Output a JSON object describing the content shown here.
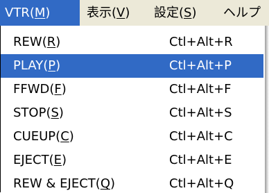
{
  "menubar": {
    "items": [
      {
        "text": "VTR",
        "mnemonic": "M",
        "active": true
      },
      {
        "text": "表示",
        "mnemonic": "V",
        "active": false
      },
      {
        "text": "設定",
        "mnemonic": "S",
        "active": false
      },
      {
        "text": "ヘルプ",
        "mnemonic": "",
        "active": false
      }
    ]
  },
  "vtr_menu": {
    "items": [
      {
        "text": "REW",
        "mnemonic": "R",
        "shortcut": "Ctl+Alt+R",
        "highlighted": false
      },
      {
        "text": "PLAY",
        "mnemonic": "P",
        "shortcut": "Ctl+Alt+P",
        "highlighted": true
      },
      {
        "text": "FFWD",
        "mnemonic": "F",
        "shortcut": "Ctl+Alt+F",
        "highlighted": false
      },
      {
        "text": "STOP",
        "mnemonic": "S",
        "shortcut": "Ctl+Alt+S",
        "highlighted": false
      },
      {
        "text": "CUEUP",
        "mnemonic": "C",
        "shortcut": "Ctl+Alt+C",
        "highlighted": false
      },
      {
        "text": "EJECT",
        "mnemonic": "E",
        "shortcut": "Ctl+Alt+E",
        "highlighted": false
      },
      {
        "text": "REW & EJECT",
        "mnemonic": "Q",
        "shortcut": "Ctl+Alt+Q",
        "highlighted": false
      }
    ]
  },
  "colors": {
    "menubar_bg": "#ece9d8",
    "highlight_bg": "#316ac5",
    "highlight_text": "#ffffff",
    "menu_bg": "#ffffff",
    "text": "#000000"
  }
}
